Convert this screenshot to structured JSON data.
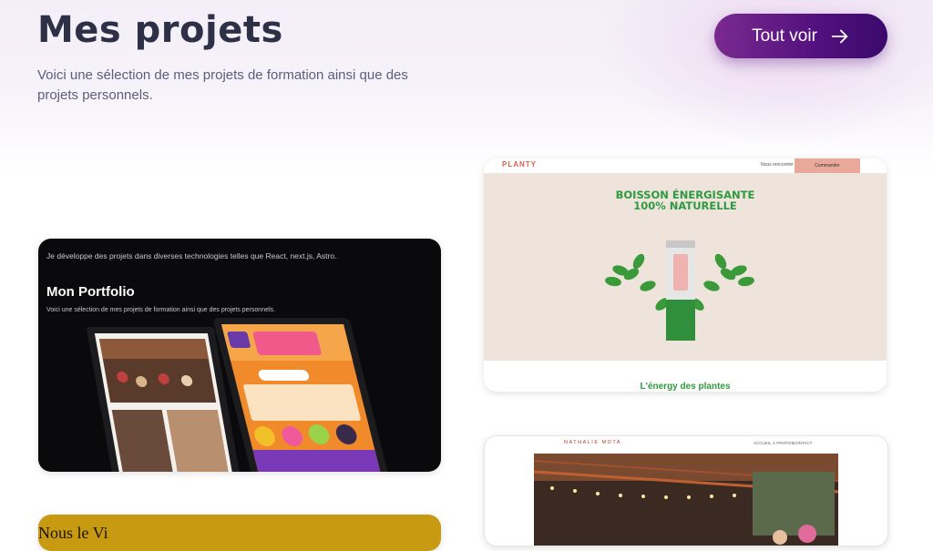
{
  "header": {
    "title": "Mes projets",
    "subtitle": "Voici une sélection de mes projets de formation ainsi que des projets personnels.",
    "cta_label": "Tout voir",
    "cta_icon": "arrow-right-icon"
  },
  "colors": {
    "title": "#2d3047",
    "subtitle": "#5a5e7c",
    "cta_gradient_start": "#7a2a8f",
    "cta_gradient_end": "#3a0a6b",
    "planty_green": "#2e9a3f",
    "planty_red": "#e05c50",
    "yellow_card": "#c89a12"
  },
  "projects": [
    {
      "id": "portfolio",
      "top_text": "Je développe des projets dans diverses technologies telles que React, next.js, Astro.",
      "title": "Mon Portfolio",
      "description": "Voici une sélection de mes projets de formation ainsi que des projets personnels."
    },
    {
      "id": "planty",
      "logo": "PLANTY",
      "nav_link": "Nous rencontrer",
      "nav_button": "Commander",
      "headline_line1": "BOISSON ÉNERGISANTE",
      "headline_line2": "100% NATURELLE",
      "tagline": "L'énergy des plantes"
    },
    {
      "id": "nathalie",
      "logo": "NATHALIE MOTA",
      "nav": [
        "ACCUEIL",
        "À PROPOS",
        "CONTACT"
      ]
    },
    {
      "id": "yellow",
      "partial_text": "Nous le Vi"
    }
  ]
}
